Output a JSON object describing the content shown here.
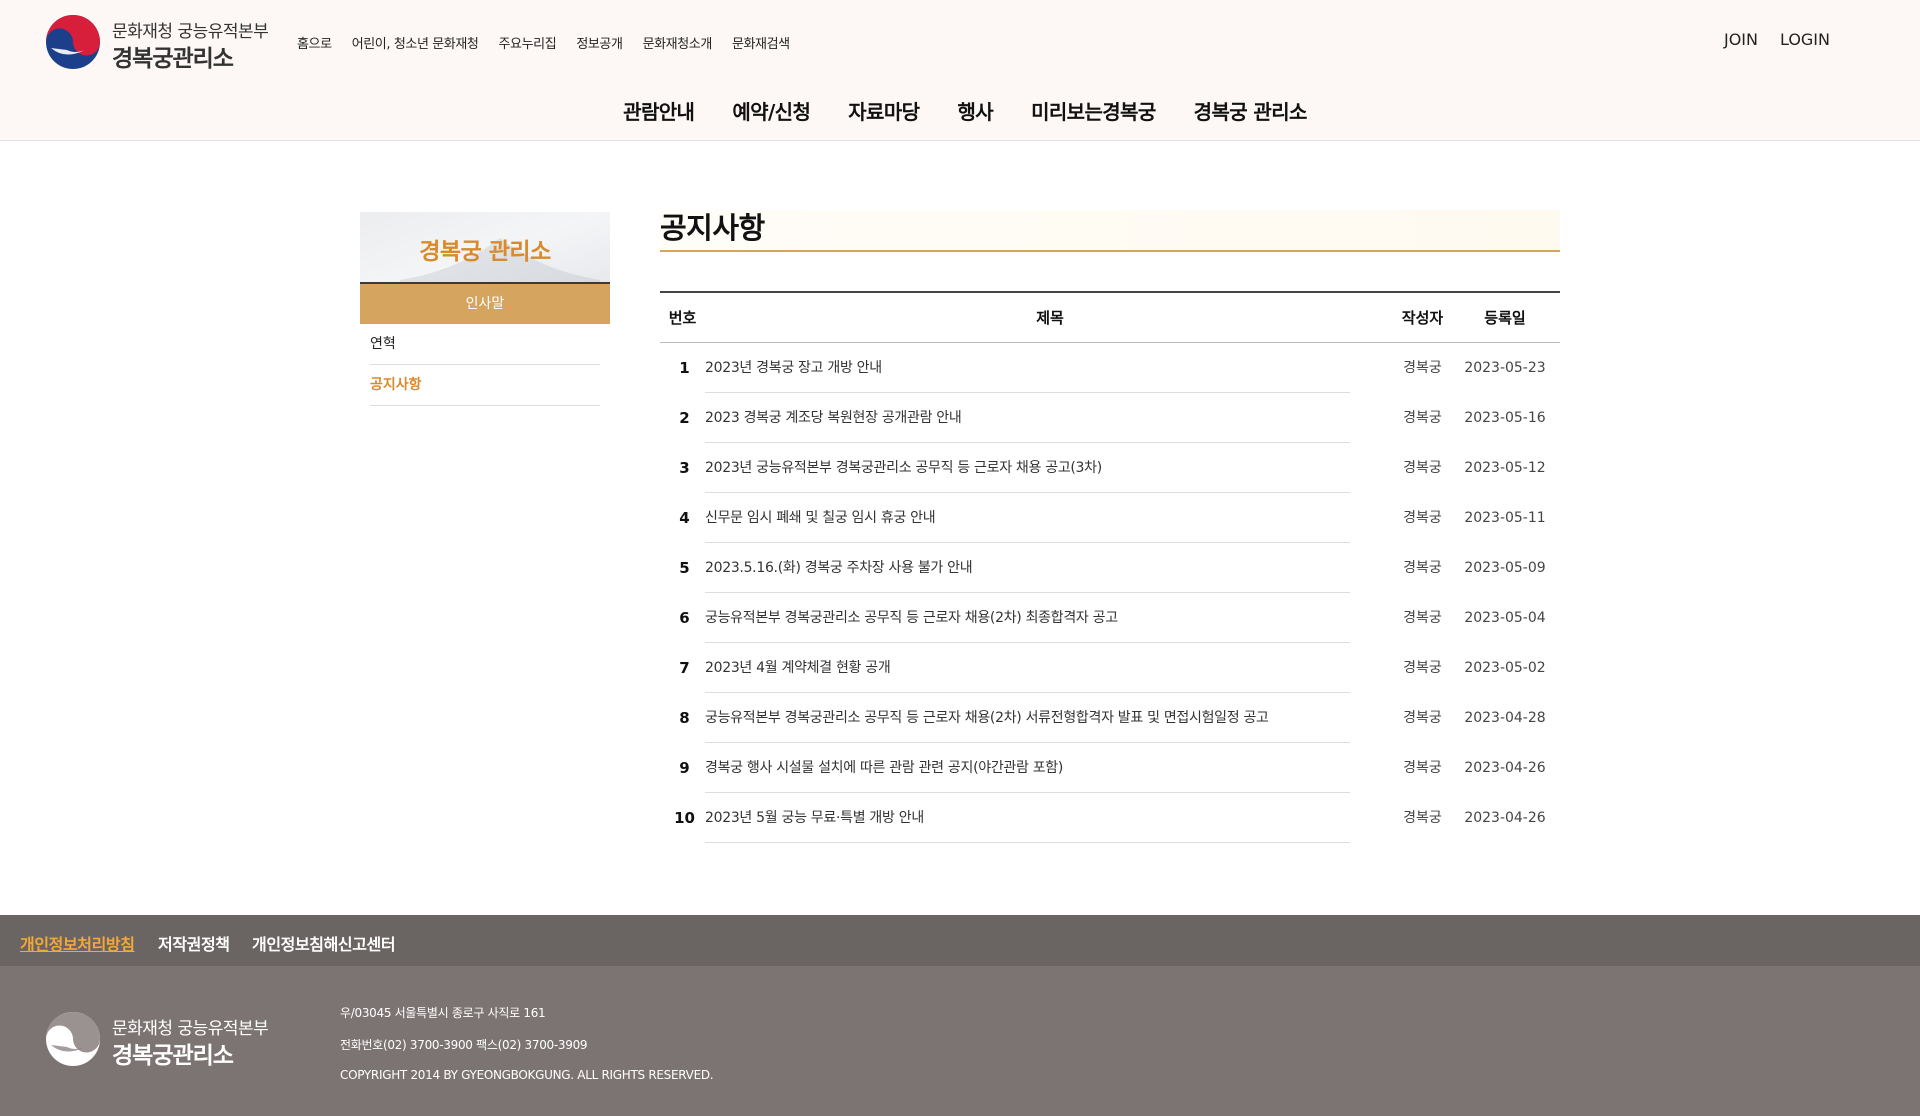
{
  "header": {
    "logo_line1": "문화재청 궁능유적본부",
    "logo_line2": "경복궁관리소",
    "util_links": [
      "홈으로",
      "어린이, 청소년 문화재청",
      "주요누리집",
      "정보공개",
      "문화재청소개",
      "문화재검색"
    ],
    "auth": {
      "join": "JOIN",
      "login": "LOGIN"
    },
    "gnb": [
      "관람안내",
      "예약/신청",
      "자료마당",
      "행사",
      "미리보는경복궁",
      "경복궁 관리소"
    ]
  },
  "side": {
    "title": "경복궁 관리소",
    "selected": "인사말",
    "items": [
      "연혁",
      "공지사항"
    ]
  },
  "content": {
    "title": "공지사항",
    "columns": {
      "no": "번호",
      "title": "제목",
      "writer": "작성자",
      "date": "등록일"
    },
    "rows": [
      {
        "no": "1",
        "title": "2023년 경복궁 장고 개방 안내",
        "writer": "경복궁",
        "date": "2023-05-23"
      },
      {
        "no": "2",
        "title": "2023 경복궁 계조당 복원현장 공개관람 안내",
        "writer": "경복궁",
        "date": "2023-05-16"
      },
      {
        "no": "3",
        "title": "2023년 궁능유적본부 경복궁관리소 공무직 등 근로자 채용 공고(3차)",
        "writer": "경복궁",
        "date": "2023-05-12"
      },
      {
        "no": "4",
        "title": "신무문 임시 폐쇄 및 칠궁 임시 휴궁 안내",
        "writer": "경복궁",
        "date": "2023-05-11"
      },
      {
        "no": "5",
        "title": "2023.5.16.(화) 경복궁 주차장 사용 불가 안내",
        "writer": "경복궁",
        "date": "2023-05-09"
      },
      {
        "no": "6",
        "title": "궁능유적본부 경복궁관리소 공무직 등 근로자 채용(2차) 최종합격자 공고",
        "writer": "경복궁",
        "date": "2023-05-04"
      },
      {
        "no": "7",
        "title": "2023년 4월 계약체결 현황 공개",
        "writer": "경복궁",
        "date": "2023-05-02"
      },
      {
        "no": "8",
        "title": "궁능유적본부 경복궁관리소 공무직 등 근로자 채용(2차) 서류전형합격자 발표 및 면접시험일정 공고",
        "writer": "경복궁",
        "date": "2023-04-28"
      },
      {
        "no": "9",
        "title": "경복궁 행사 시설물 설치에 따른 관람 관련 공지(야간관람 포함)",
        "writer": "경복궁",
        "date": "2023-04-26"
      },
      {
        "no": "10",
        "title": "2023년 5월 궁능 무료·특별 개방 안내",
        "writer": "경복궁",
        "date": "2023-04-26"
      }
    ]
  },
  "footer": {
    "links": [
      "개인정보처리방침",
      "저작권정책",
      "개인정보침해신고센터"
    ],
    "logo_line1": "문화재청 궁능유적본부",
    "logo_line2": "경복궁관리소",
    "address": "우/03045 서울특별시 종로구 사직로 161",
    "phone": "전화번호(02) 3700-3900 팩스(02) 3700-3909",
    "copyright": "COPYRIGHT 2014 BY GYEONGBOKGUNG. ALL RIGHTS RESERVED."
  },
  "colors": {
    "accent": "#d5a55f",
    "accent_text": "#d88a2c",
    "footer_bar": "#6a6463",
    "footer_body": "#7c7473",
    "footer_highlight": "#f2a83a"
  }
}
